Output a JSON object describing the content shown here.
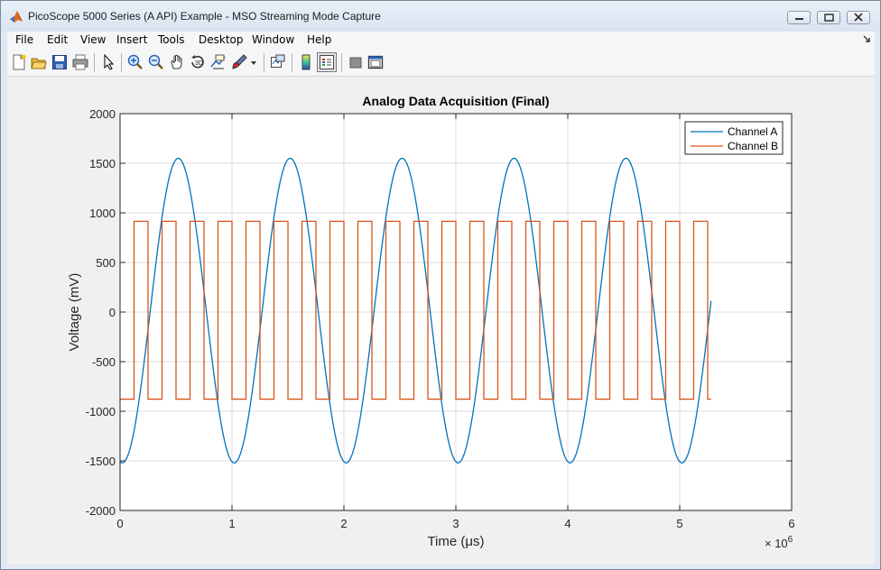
{
  "window": {
    "title": "PicoScope 5000 Series (A API) Example - MSO Streaming Mode Capture"
  },
  "menu": [
    "File",
    "Edit",
    "View",
    "Insert",
    "Tools",
    "Desktop",
    "Window",
    "Help"
  ],
  "toolbar": {
    "icons": [
      "new-figure-icon",
      "open-file-icon",
      "save-icon",
      "print-icon",
      "edit-plot-arrow-icon",
      "zoom-in-icon",
      "zoom-out-icon",
      "pan-hand-icon",
      "rotate-3d-icon",
      "data-cursor-icon",
      "brush-icon",
      "brush-dropdown-icon",
      "link-plot-icon",
      "colorbar-icon",
      "legend-icon",
      "hide-plot-tools-icon",
      "show-plot-tools-icon"
    ]
  },
  "chart_data": {
    "type": "line",
    "title": "Analog Data Acquisition (Final)",
    "xlabel": "Time (μs)",
    "ylabel": "Voltage (mV)",
    "x_exponent_label": "× 10",
    "x_exponent": "6",
    "xlim": [
      0,
      6000000
    ],
    "ylim": [
      -2000,
      2000
    ],
    "xticks": [
      "0",
      "1",
      "2",
      "3",
      "4",
      "5",
      "6"
    ],
    "yticks": [
      "-2000",
      "-1500",
      "-1000",
      "-500",
      "0",
      "500",
      "1000",
      "1500",
      "2000"
    ],
    "grid": true,
    "legend": "top-right",
    "series": [
      {
        "name": "Channel A",
        "color": "#0072bd",
        "kind": "sine",
        "amplitude_mv": 1535,
        "offset_mv": 15,
        "period_us": 1000000,
        "phase_peak_at_us": 520000,
        "x_start": 0,
        "x_end": 5280000
      },
      {
        "name": "Channel B",
        "color": "#d95319",
        "kind": "square",
        "high_mv": 915,
        "low_mv": -878,
        "period_us": 250000,
        "first_rise_us": 125000,
        "duty": 0.5,
        "x_start": 0,
        "x_end": 5280000
      }
    ]
  }
}
